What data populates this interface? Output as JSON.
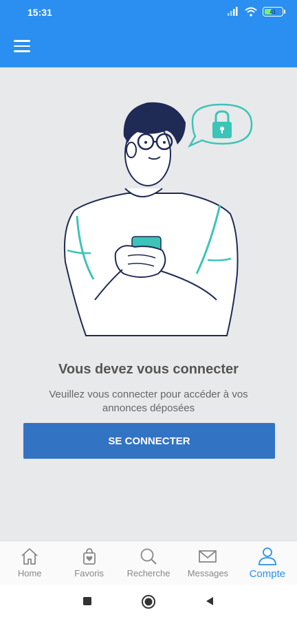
{
  "status_bar": {
    "time": "15:31",
    "battery": "41",
    "battery_level": 0.41,
    "icons": [
      "signal-icon",
      "wifi-icon",
      "battery-icon"
    ]
  },
  "app_bar": {
    "menu_icon": "hamburger-menu-icon",
    "background": "#2a8ff0"
  },
  "main": {
    "title": "Vous devez vous connecter",
    "subtitle_line1": "Veuillez vous connecter pour accéder à vos",
    "subtitle_line2": "annonces déposées",
    "login_button": "SE CONNECTER",
    "illustration": "person-with-phone-and-lock-illustration"
  },
  "bottom_nav": {
    "items": [
      {
        "label": "Home",
        "icon": "home-icon"
      },
      {
        "label": "Favoris",
        "icon": "favorites-bag-icon"
      },
      {
        "label": "Recherche",
        "icon": "search-icon"
      },
      {
        "label": "Messages",
        "icon": "envelope-icon"
      },
      {
        "label": "Compte",
        "icon": "user-icon",
        "active": true
      }
    ]
  },
  "system_nav": {
    "icons": [
      "square-recents-icon",
      "circle-home-icon",
      "triangle-back-icon"
    ]
  },
  "colors": {
    "primary": "#2a8ff0",
    "button": "#3373c4",
    "background": "#e8e9ea",
    "accent": "#3cc4b8"
  }
}
